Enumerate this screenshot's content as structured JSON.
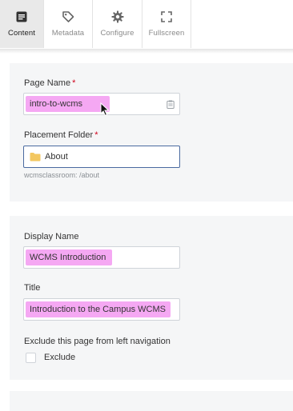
{
  "tabs": [
    {
      "label": "Content",
      "icon": "document-icon",
      "active": true
    },
    {
      "label": "Metadata",
      "icon": "tag-icon",
      "active": false
    },
    {
      "label": "Configure",
      "icon": "gear-icon",
      "active": false
    },
    {
      "label": "Fullscreen",
      "icon": "fullscreen-icon",
      "active": false
    }
  ],
  "page_name": {
    "label": "Page Name",
    "required_marker": "*",
    "value": "intro-to-wcms"
  },
  "placement_folder": {
    "label": "Placement Folder",
    "required_marker": "*",
    "value": "About",
    "hint": "wcmsclassroom: /about"
  },
  "display_name": {
    "label": "Display Name",
    "value": "WCMS Introduction"
  },
  "title": {
    "label": "Title",
    "value": "Introduction to the Campus WCMS"
  },
  "exclude_nav": {
    "label": "Exclude this page from left navigation",
    "checkbox_label": "Exclude",
    "checked": false
  },
  "colors": {
    "highlight": "#f5a8f3",
    "required": "#d0021b",
    "active_tab_bg": "#e9e9e9",
    "folder_icon": "#f3c760"
  }
}
